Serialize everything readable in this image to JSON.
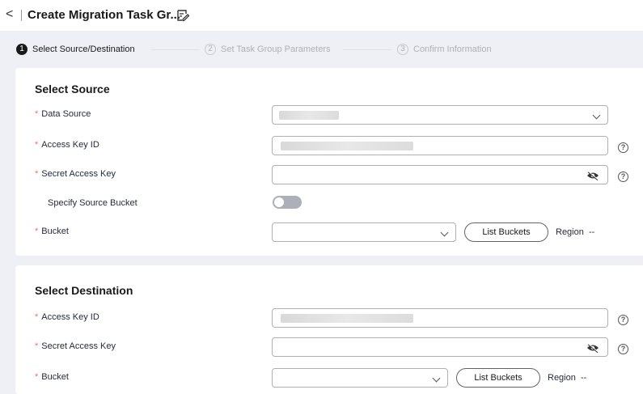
{
  "header": {
    "back_symbol": "<",
    "title": "Create Migration Task Gr..."
  },
  "steps": [
    {
      "num": "1",
      "label": "Select Source/Destination",
      "state": "active"
    },
    {
      "num": "2",
      "label": "Set Task Group Parameters",
      "state": "inactive"
    },
    {
      "num": "3",
      "label": "Confirm Information",
      "state": "inactive"
    }
  ],
  "source": {
    "title": "Select Source",
    "data_source_label": "Data Source",
    "access_key_label": "Access Key ID",
    "secret_key_label": "Secret Access Key",
    "specify_bucket_label": "Specify Source Bucket",
    "specify_bucket_on": false,
    "bucket_label": "Bucket",
    "list_buckets": "List Buckets",
    "region_label": "Region",
    "region_value": "--"
  },
  "destination": {
    "title": "Select Destination",
    "access_key_label": "Access Key ID",
    "secret_key_label": "Secret Access Key",
    "bucket_label": "Bucket",
    "list_buckets": "List Buckets",
    "region_label": "Region",
    "region_value": "--"
  },
  "required_mark": "*",
  "help_glyph": "?",
  "colors": {
    "required": "#f66f6a",
    "active_step": "#191919",
    "inactive_step": "#adb0b8",
    "page_bg": "#eef0f5"
  }
}
